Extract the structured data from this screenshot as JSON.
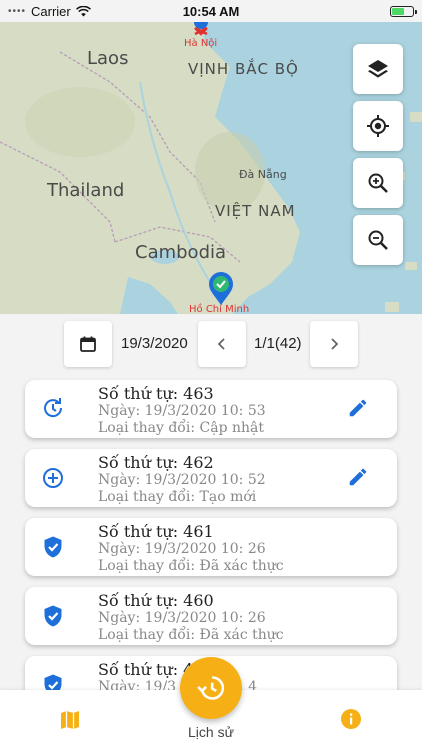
{
  "status_bar": {
    "carrier": "Carrier",
    "time": "10:54 AM"
  },
  "map": {
    "labels": {
      "laos": "Laos",
      "ha_noi": "Hà Nội",
      "vinh_bac_bo": "VỊNH BẮC BỘ",
      "da_nang": "Đà Nẵng",
      "thailand": "Thailand",
      "viet_nam": "VIỆT NAM",
      "cambodia": "Cambodia",
      "ho_chi_minh": "Hồ Chí Minh"
    },
    "buttons": [
      "layers",
      "my-location",
      "zoom-in",
      "zoom-out"
    ]
  },
  "date_nav": {
    "date": "19/3/2020",
    "page": "1/1(42)"
  },
  "records": [
    {
      "title": "Số thứ tự: 463",
      "date": "Ngày: 19/3/2020 10: 53",
      "change": "Loại thay đổi: Cập nhật",
      "icon": "update-icon",
      "editable": true
    },
    {
      "title": "Số thứ tự: 462",
      "date": "Ngày: 19/3/2020 10: 52",
      "change": "Loại thay đổi: Tạo mới",
      "icon": "add-circle-icon",
      "editable": true
    },
    {
      "title": "Số thứ tự: 461",
      "date": "Ngày: 19/3/2020 10: 26",
      "change": "Loại thay đổi: Đã xác thực",
      "icon": "verified-shield-icon",
      "editable": false
    },
    {
      "title": "Số thứ tự: 460",
      "date": "Ngày: 19/3/2020 10: 26",
      "change": "Loại thay đổi: Đã xác thực",
      "icon": "verified-shield-icon",
      "editable": false
    },
    {
      "title": "Số thứ tự: 4",
      "date": "Ngày: 19/3",
      "date_tail": "4",
      "change": "",
      "icon": "verified-shield-icon",
      "editable": false
    }
  ],
  "bottom_bar": {
    "history_label": "Lịch sử"
  },
  "colors": {
    "accent_blue": "#1e6fd9",
    "fab_orange": "#f6b016",
    "sea": "#aad3df",
    "land": "#d9dfc8"
  }
}
